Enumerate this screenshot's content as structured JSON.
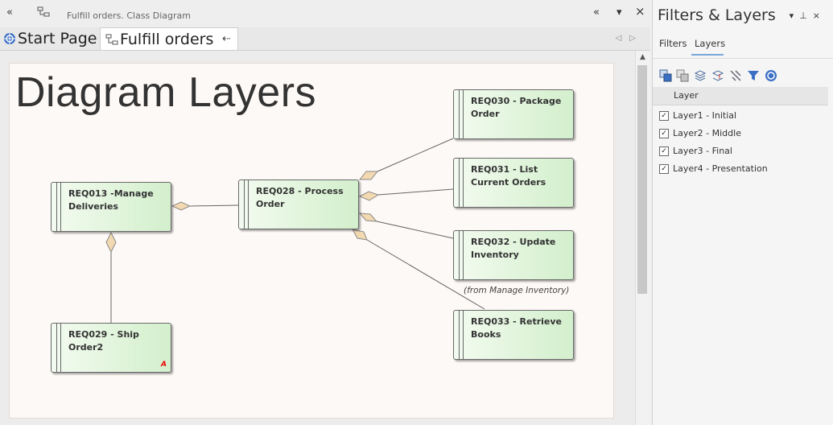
{
  "window": {
    "diagram_caption": "Fulfill orders.  Class Diagram",
    "collapse_glyph": "«",
    "menu_glyph": "▾",
    "close_glyph": "×"
  },
  "tabs": [
    {
      "label": "Start Page",
      "icon": "start-page-icon"
    },
    {
      "label": "Fulfill orders",
      "icon": "class-diagram-icon",
      "pin_glyph": "⇠"
    }
  ],
  "tab_nav": {
    "left": "◁",
    "right": "▷"
  },
  "diagram": {
    "title": "Diagram Layers",
    "elements": [
      {
        "id": "req013",
        "label": "REQ013 -Manage Deliveries"
      },
      {
        "id": "req028",
        "label": "REQ028 - Process Order"
      },
      {
        "id": "req029",
        "label": "REQ029 - Ship Order2",
        "flag": "A"
      },
      {
        "id": "req030",
        "label": "REQ030 - Package Order"
      },
      {
        "id": "req031",
        "label": "REQ031 - List Current Orders"
      },
      {
        "id": "req032",
        "label": "REQ032 - Update Inventory"
      },
      {
        "id": "req033",
        "label": "REQ033 - Retrieve Books"
      }
    ],
    "from_note": "(from Manage Inventory)"
  },
  "panel": {
    "title": "Filters & Layers",
    "tabs": [
      "Filters",
      "Layers"
    ],
    "active_tab": "Layers",
    "toolbar_icons": [
      "add-layer-icon",
      "remove-layer-icon",
      "layer-up-icon",
      "layer-down-icon",
      "unlink-icon",
      "filter-icon",
      "help-icon"
    ],
    "column_header": "Layer",
    "layers": [
      {
        "name": "Layer1 - Initial",
        "checked": true
      },
      {
        "name": "Layer2 - Middle",
        "checked": true
      },
      {
        "name": "Layer3 - Final",
        "checked": true
      },
      {
        "name": "Layer4 - Presentation",
        "checked": true
      }
    ],
    "check_glyph": "✓",
    "pin_glyph": "⊥"
  },
  "colors": {
    "accent": "#7aa7d8",
    "element_fill": "#d3efcc",
    "diamond": "#f3d9b1"
  }
}
